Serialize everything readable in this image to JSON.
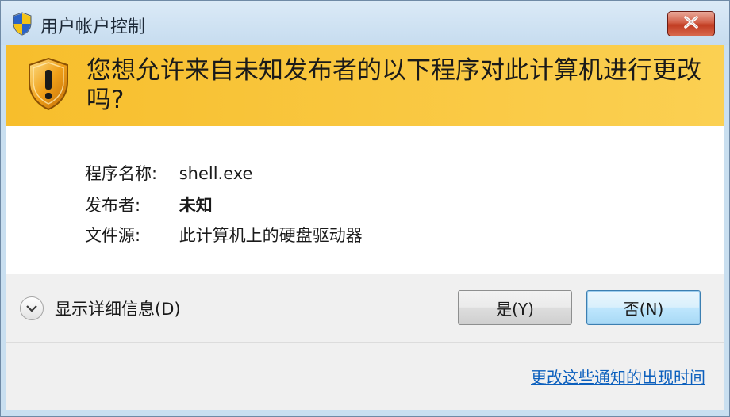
{
  "window": {
    "title": "用户帐户控制"
  },
  "banner": {
    "question": "您想允许来自未知发布者的以下程序对此计算机进行更改吗?"
  },
  "info": {
    "program_label": "程序名称:",
    "program_value": "shell.exe",
    "publisher_label": "发布者:",
    "publisher_value": "未知",
    "source_label": "文件源:",
    "source_value": "此计算机上的硬盘驱动器"
  },
  "footer": {
    "details_label": "显示详细信息(D)",
    "yes_label": "是(Y)",
    "no_label": "否(N)",
    "settings_link": "更改这些通知的出现时间"
  },
  "icons": {
    "title": "uac-shield-icon",
    "banner": "warning-shield-icon",
    "close": "close-icon",
    "details": "chevron-down-icon"
  },
  "colors": {
    "banner": "#f7be2c",
    "link": "#0b5fbd",
    "close_button": "#c13c22"
  }
}
